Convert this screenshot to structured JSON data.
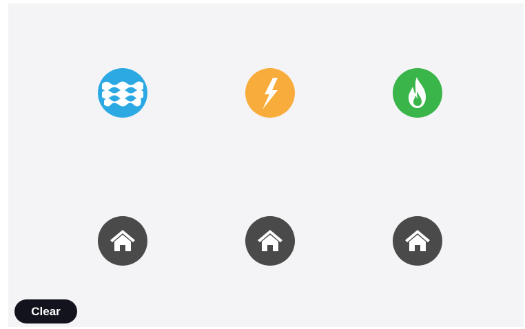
{
  "colors": {
    "background": "#f4f4f6",
    "water": "#2ca9e3",
    "electric": "#f8ac3b",
    "gas": "#3ab54a",
    "house": "#4b4a4a",
    "button": "#13131d"
  },
  "sources": [
    {
      "icon": "water-waves-icon"
    },
    {
      "icon": "lightning-bolt-icon"
    },
    {
      "icon": "flame-icon"
    }
  ],
  "houses": [
    {
      "icon": "house-icon"
    },
    {
      "icon": "house-icon"
    },
    {
      "icon": "house-icon"
    }
  ],
  "clear_button": {
    "label": "Clear"
  }
}
